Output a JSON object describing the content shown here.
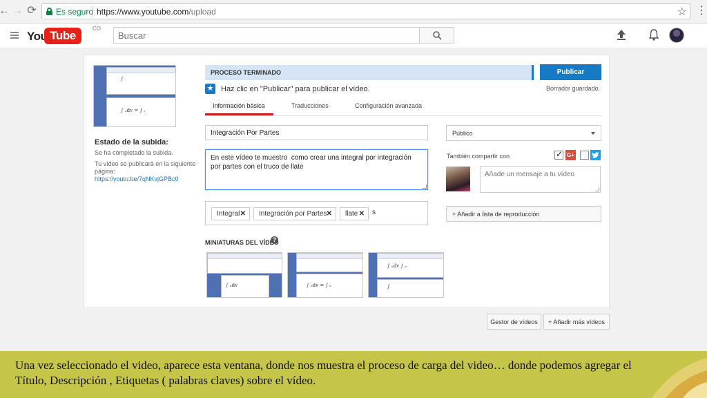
{
  "browser": {
    "secure_label": "Es seguro",
    "url_host": "https://www.youtube.com",
    "url_path": "/upload"
  },
  "header": {
    "logo_you": "You",
    "logo_tube": "Tube",
    "logo_country": "CO",
    "search_placeholder": "Buscar"
  },
  "upload": {
    "status_title": "Estado de la subida:",
    "status_complete": "Se ha completado la subida.",
    "publish_note_1": "Tu vídeo se publicará en la siguiente",
    "publish_note_2": "página:",
    "video_url": "https://youtu.be/7qNKvjGPBc0",
    "process_label": "PROCESO TERMINADO",
    "publish_button": "Publicar",
    "draft_saved": "Borrador guardado.",
    "publish_hint": "Haz clic en \"Publicar\" para publicar el vídeo."
  },
  "tabs": [
    {
      "label": "Información básica",
      "active": true
    },
    {
      "label": "Traducciones",
      "active": false
    },
    {
      "label": "Configuración avanzada",
      "active": false
    }
  ],
  "form": {
    "title": "Integración Por Partes",
    "description": "En este vídeo te muestro  como crear una integral por integración por partes con el truco de llate",
    "tags": [
      "Integral",
      "Integración por Partes",
      "llate"
    ],
    "tag_input": "s",
    "privacy": "Público",
    "share_label": "También compartir con",
    "share_message_placeholder": "Añade un mensaje a tu vídeo",
    "playlist_button": "+ Añadir a lista de reproducción",
    "thumbnails_title": "MINIATURAS DEL VÍDEO",
    "help": "?"
  },
  "share": {
    "gplus_label": "G+",
    "gplus_checked": true,
    "twitter_checked": false
  },
  "footer": {
    "manager_button": "Gestor de vídeos",
    "add_more_button": "+ Añadir más vídeos"
  },
  "caption": {
    "text": "Una  vez seleccionado el video, aparece esta ventana, donde nos muestra el proceso de carga del video…  donde podemos agregar el Título, Descripción , Etiquetas ( palabras claves) sobre el vídeo."
  },
  "colors": {
    "accent_blue": "#167ac6",
    "youtube_red": "#e62117",
    "caption_bg": "#c5c54a"
  }
}
